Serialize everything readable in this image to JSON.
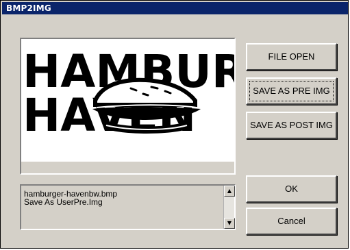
{
  "window": {
    "title": "BMP2IMG"
  },
  "preview": {
    "image_label": "HAMBURGER HAVEN logo"
  },
  "log": {
    "lines": [
      "hamburger-havenbw.bmp",
      "Save As UserPre.Img"
    ]
  },
  "buttons": {
    "file_open": "FILE OPEN",
    "save_pre": "SAVE AS PRE IMG",
    "save_post": "SAVE AS POST IMG",
    "ok": "OK",
    "cancel": "Cancel"
  },
  "icons": {
    "scroll_up": "scroll-up-arrow-icon",
    "scroll_down": "scroll-down-arrow-icon"
  }
}
